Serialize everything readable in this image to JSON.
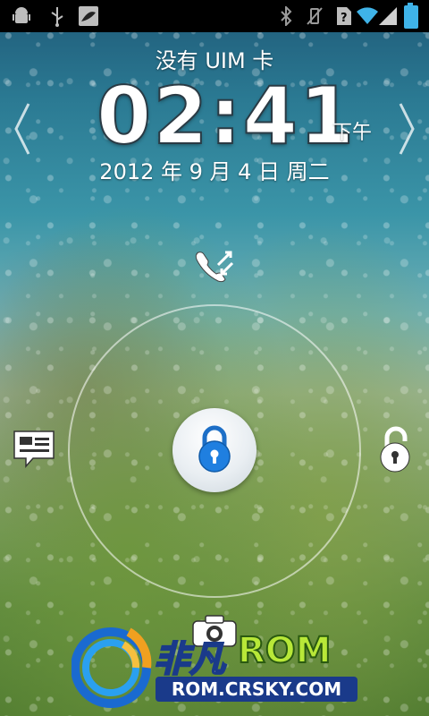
{
  "status_bar": {
    "left_icons": [
      "android-debug-icon",
      "usb-icon",
      "pea-app-icon"
    ],
    "right_icons": [
      "bluetooth-icon",
      "vibrate-icon",
      "no-sim-icon",
      "wifi-icon",
      "signal-icon",
      "battery-icon"
    ],
    "battery_color": "#3fb3e8"
  },
  "lockscreen": {
    "sim_status": "没有 UIM 卡",
    "time": "02:41",
    "ampm": "下午",
    "date": "2012 年 9 月 4 日 周二",
    "targets": {
      "top": "call-log-icon",
      "left": "messages-icon",
      "right": "unlock-icon",
      "bottom": "camera-icon"
    },
    "handle_icon": "lock-icon"
  },
  "watermark": {
    "title": "非凡",
    "rom": "ROM",
    "url": "ROM.CRSKY.COM"
  }
}
